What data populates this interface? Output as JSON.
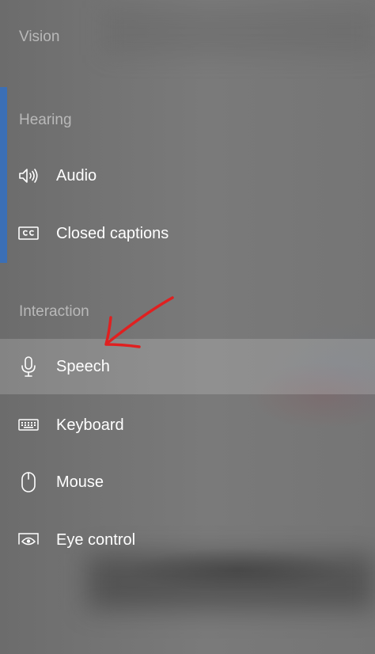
{
  "sections": [
    {
      "title": "Vision"
    },
    {
      "title": "Hearing"
    },
    {
      "title": "Interaction"
    }
  ],
  "hearing_items": [
    {
      "label": "Audio",
      "icon": "speaker-icon"
    },
    {
      "label": "Closed captions",
      "icon": "closed-captions-icon"
    }
  ],
  "interaction_items": [
    {
      "label": "Speech",
      "icon": "microphone-icon",
      "selected": true
    },
    {
      "label": "Keyboard",
      "icon": "keyboard-icon"
    },
    {
      "label": "Mouse",
      "icon": "mouse-icon"
    },
    {
      "label": "Eye control",
      "icon": "eye-control-icon"
    }
  ],
  "colors": {
    "accent": "#3b6fb6",
    "annotation_arrow": "#e02020",
    "section_title": "#b9b9b9",
    "item_text": "#ffffff"
  }
}
